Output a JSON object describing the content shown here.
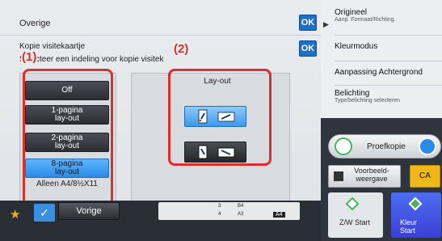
{
  "header": {
    "title": "Overige",
    "ok_label": "OK"
  },
  "dialog": {
    "title": "Kopie visitekaartje",
    "description": "Selecteer een indeling voor kopie visitek",
    "ok_label": "OK"
  },
  "callouts": {
    "one": "(1)",
    "two": "(2)"
  },
  "layout_options": [
    {
      "label": "Off",
      "selected": false
    },
    {
      "label": "1-pagina lay-out",
      "selected": false
    },
    {
      "label": "2-pagina lay-out",
      "selected": false
    },
    {
      "label": "8-pagina lay-out",
      "selected": true
    }
  ],
  "note": "Alleen A4/8½X11",
  "layout_panel": {
    "label": "Lay-out"
  },
  "bottom": {
    "prev_label": "Vorige",
    "tray": {
      "t1": "3",
      "t2": "B4",
      "t3": "4",
      "t4": "A3",
      "badge": "A4"
    }
  },
  "side": {
    "origineel": {
      "label": "Origineel",
      "sub": "Aanp. Formaat/Richting."
    },
    "kleurmodus": {
      "label": "Kleurmodus"
    },
    "achtergrond": {
      "label": "Aanpassing Achtergrond"
    },
    "belichting": {
      "label": "Belichting",
      "sub": "Type/belichting selecteren"
    },
    "proefkopie": "Proefkopie",
    "preview": "Voorbeeld-weergave",
    "ca": "CA",
    "zw_start": "Z/W Start",
    "kleur_start": "Kleur Start"
  },
  "colors": {
    "accent": "#2a8be6",
    "callout": "#d8312d",
    "ca": "#f0b718"
  }
}
